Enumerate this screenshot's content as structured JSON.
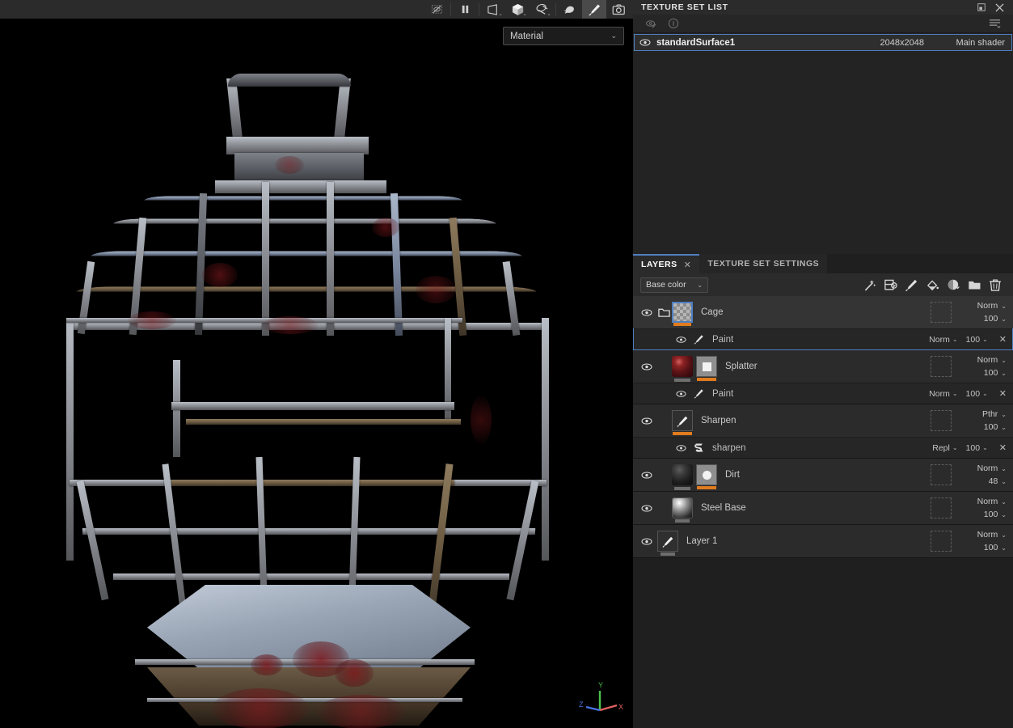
{
  "viewport": {
    "toolbar": [
      {
        "name": "toggle-uv-overlay-icon",
        "label": "",
        "active": false,
        "caret": false,
        "icon": "eye-slash-box"
      },
      {
        "name": "pause-engine-icon",
        "label": "",
        "active": false,
        "caret": false,
        "icon": "pause"
      },
      {
        "name": "camera-view-icon",
        "label": "",
        "active": false,
        "caret": true,
        "icon": "frustum"
      },
      {
        "name": "view-mode-3d-icon",
        "label": "",
        "active": false,
        "caret": true,
        "icon": "cube"
      },
      {
        "name": "display-settings-icon",
        "label": "",
        "active": false,
        "caret": true,
        "icon": "material-ball"
      },
      {
        "name": "environment-icon",
        "label": "",
        "active": false,
        "caret": false,
        "icon": "shell"
      },
      {
        "name": "paint-tool-icon",
        "label": "",
        "active": true,
        "caret": false,
        "icon": "brush"
      },
      {
        "name": "screenshot-icon",
        "label": "",
        "active": false,
        "caret": false,
        "icon": "camera"
      }
    ],
    "material_dropdown": {
      "value": "Material",
      "caret": "⌄"
    },
    "axis_gizmo": {
      "x_label": "X",
      "y_label": "Y",
      "z_label": "Z",
      "x_color": "#e06060",
      "y_color": "#4bc04b",
      "z_color": "#4a6fe0"
    }
  },
  "texture_set_list": {
    "title": "TEXTURE SET LIST",
    "restore_icon": "restore-icon",
    "close_icon": "close-icon",
    "toolbar": {
      "toggle_visibility_icon": "eye-check-icon",
      "info_icon": "info-icon",
      "menu_icon": "list-menu-icon"
    },
    "rows": [
      {
        "name": "standardSurface1",
        "resolution": "2048x2048",
        "shader": "Main shader",
        "visible": true,
        "selected": true
      }
    ]
  },
  "layers_panel": {
    "tabs": [
      {
        "label": "LAYERS",
        "active": true,
        "closable": true,
        "close_glyph": "✕"
      },
      {
        "label": "TEXTURE SET SETTINGS",
        "active": false,
        "closable": false,
        "close_glyph": ""
      }
    ],
    "channel_selector": {
      "value": "Base color",
      "caret": "⌄"
    },
    "toolbar_icons": [
      {
        "name": "add-smart-material-icon",
        "title": "Add smart material"
      },
      {
        "name": "add-smart-mask-icon",
        "title": "Add smart mask"
      },
      {
        "name": "add-paint-layer-icon",
        "title": "Add paint layer"
      },
      {
        "name": "add-fill-layer-icon",
        "title": "Add fill layer"
      },
      {
        "name": "add-adjustment-layer-icon",
        "title": "Add adjustment"
      },
      {
        "name": "add-folder-icon",
        "title": "Add folder"
      },
      {
        "name": "delete-layer-icon",
        "title": "Delete layer"
      }
    ],
    "layers": [
      {
        "id": "cage",
        "name": "Cage",
        "kind": "folder",
        "visible": true,
        "selected": true,
        "thumb": "checker",
        "thumb_selected": true,
        "has_mask_thumb": false,
        "underbar": "orange",
        "blend_mode": "Norm",
        "opacity": "100",
        "mask_placeholder": true,
        "effects": [
          {
            "name": "Paint",
            "icon": "brush-icon",
            "visible": true,
            "blend_mode": "Norm",
            "opacity": "100",
            "remove_glyph": "✕"
          }
        ]
      },
      {
        "id": "splatter",
        "name": "Splatter",
        "kind": "fill",
        "visible": true,
        "selected": false,
        "thumb": "sphere-red",
        "thumb_selected": false,
        "has_mask_thumb": true,
        "mask_shape": "square",
        "underbar": "gray",
        "mask_underbar": "orange",
        "blend_mode": "Norm",
        "opacity": "100",
        "mask_placeholder": true,
        "effects": [
          {
            "name": "Paint",
            "icon": "brush-icon",
            "visible": true,
            "blend_mode": "Norm",
            "opacity": "100",
            "remove_glyph": "✕"
          }
        ]
      },
      {
        "id": "sharpen",
        "name": "Sharpen",
        "kind": "paint",
        "visible": true,
        "selected": false,
        "thumb": "brush",
        "thumb_selected": false,
        "has_mask_thumb": false,
        "underbar": "orange",
        "blend_mode": "Pthr",
        "opacity": "100",
        "mask_placeholder": true,
        "effects": [
          {
            "name": "sharpen",
            "icon": "filter-icon",
            "visible": true,
            "blend_mode": "Repl",
            "opacity": "100",
            "remove_glyph": "✕"
          }
        ]
      },
      {
        "id": "dirt",
        "name": "Dirt",
        "kind": "fill",
        "visible": true,
        "selected": false,
        "thumb": "sphere-dark",
        "thumb_selected": false,
        "has_mask_thumb": true,
        "mask_shape": "round",
        "underbar": "gray",
        "mask_underbar": "orange",
        "blend_mode": "Norm",
        "opacity": "48",
        "mask_placeholder": true,
        "effects": []
      },
      {
        "id": "steel-base",
        "name": "Steel Base",
        "kind": "fill",
        "visible": true,
        "selected": false,
        "thumb": "sphere-steel",
        "thumb_selected": false,
        "has_mask_thumb": false,
        "underbar": "gray",
        "blend_mode": "Norm",
        "opacity": "100",
        "mask_placeholder": true,
        "effects": []
      },
      {
        "id": "layer-1",
        "name": "Layer 1",
        "kind": "paint",
        "visible": true,
        "selected": false,
        "thumb": "brush",
        "thumb_selected": false,
        "has_mask_thumb": false,
        "underbar": "gray",
        "blend_mode": "Norm",
        "opacity": "100",
        "mask_placeholder": true,
        "effects": []
      }
    ]
  },
  "colors": {
    "accent_blue": "#4f7fc0",
    "accent_orange": "#e07b1e",
    "panel_bg": "#1f1f1f",
    "row_bg": "#2b2b2b",
    "title_bg": "#2b2b2b",
    "viewport_bg": "#000000"
  }
}
